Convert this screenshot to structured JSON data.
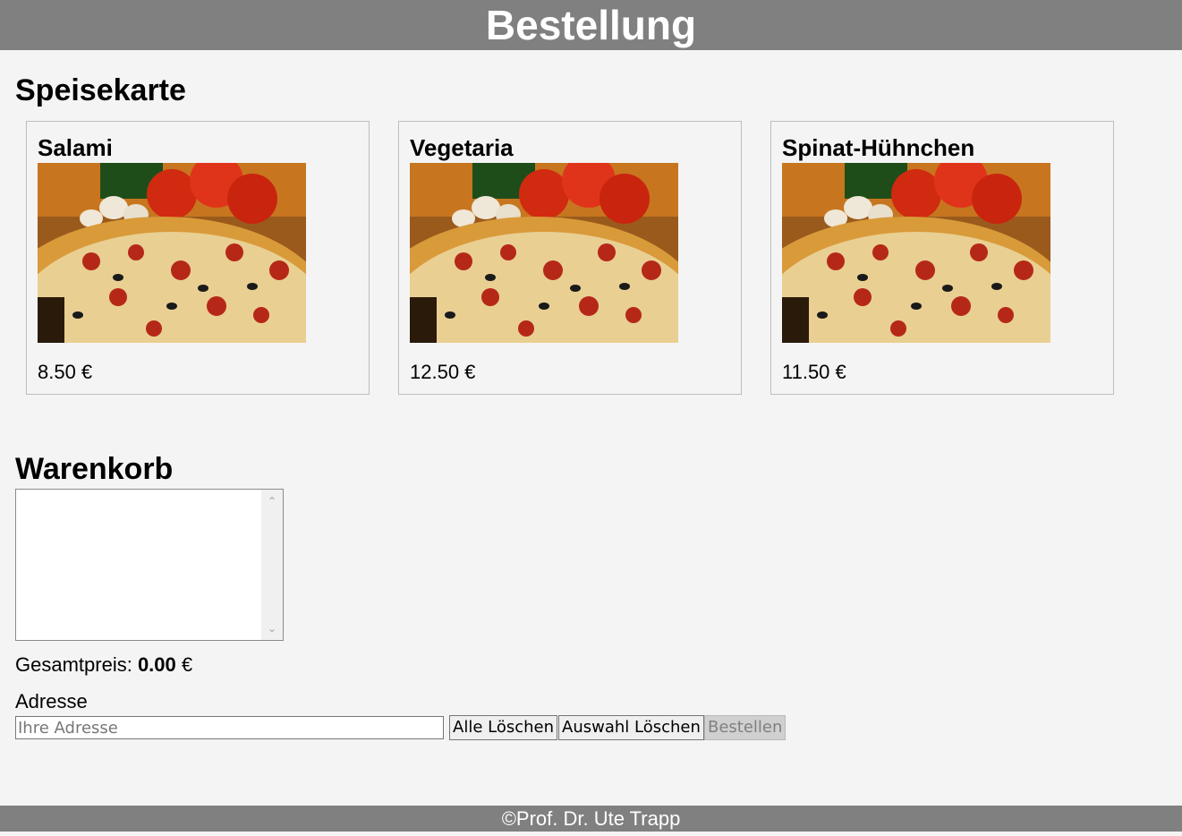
{
  "header": {
    "title": "Bestellung"
  },
  "menu": {
    "title": "Speisekarte",
    "items": [
      {
        "name": "Salami",
        "price": "8.50 €"
      },
      {
        "name": "Vegetaria",
        "price": "12.50 €"
      },
      {
        "name": "Spinat-Hühnchen",
        "price": "11.50 €"
      }
    ]
  },
  "cart": {
    "title": "Warenkorb",
    "total_label": "Gesamtpreis: ",
    "total_value": "0.00",
    "total_currency": " €",
    "address_label": "Adresse",
    "address_placeholder": "Ihre Adresse",
    "address_value": "",
    "buttons": {
      "delete_all": "Alle Löschen",
      "delete_selection": "Auswahl Löschen",
      "order": "Bestellen"
    }
  },
  "footer": {
    "text": "©Prof. Dr. Ute Trapp"
  }
}
